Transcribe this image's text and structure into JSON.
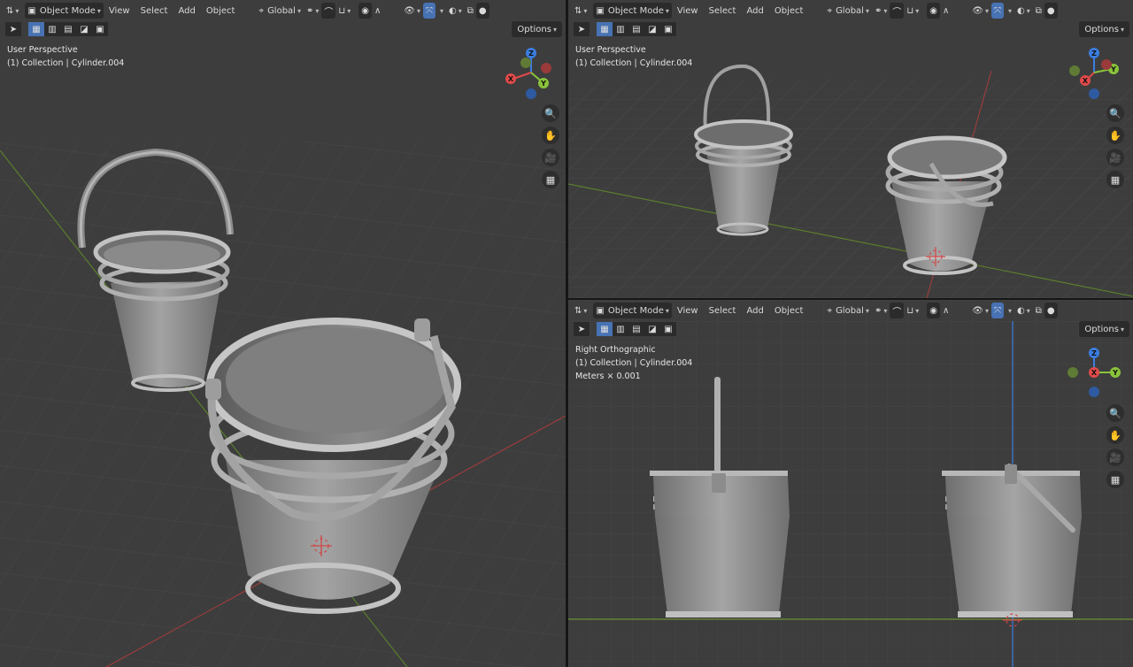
{
  "viewports": [
    {
      "id": "left",
      "title": "User Perspective",
      "collection": "(1) Collection | Cylinder.004",
      "units": ""
    },
    {
      "id": "top-right",
      "title": "User Perspective",
      "collection": "(1) Collection | Cylinder.004",
      "units": ""
    },
    {
      "id": "bottom-right",
      "title": "Right Orthographic",
      "collection": "(1) Collection | Cylinder.004",
      "units": "Meters × 0.001"
    }
  ],
  "header": {
    "mode": "Object Mode",
    "menus": [
      "View",
      "Select",
      "Add",
      "Object"
    ],
    "orientation": "Global",
    "options_label": "Options"
  },
  "gizmo": {
    "x": "X",
    "y": "Y",
    "z": "Z"
  },
  "icons": {
    "editor_type": "editor-type-icon",
    "select_tool": "cursor-arrow-icon",
    "zoom": "zoom-icon",
    "pan": "hand-icon",
    "camera": "camera-icon",
    "persp": "perspective-grid-icon"
  },
  "colors": {
    "x_axis": "#e14a4a",
    "y_axis": "#8ac33b",
    "z_axis": "#3b7ee1",
    "accent": "#4772b3",
    "viewport_bg": "#3d3d3d"
  }
}
